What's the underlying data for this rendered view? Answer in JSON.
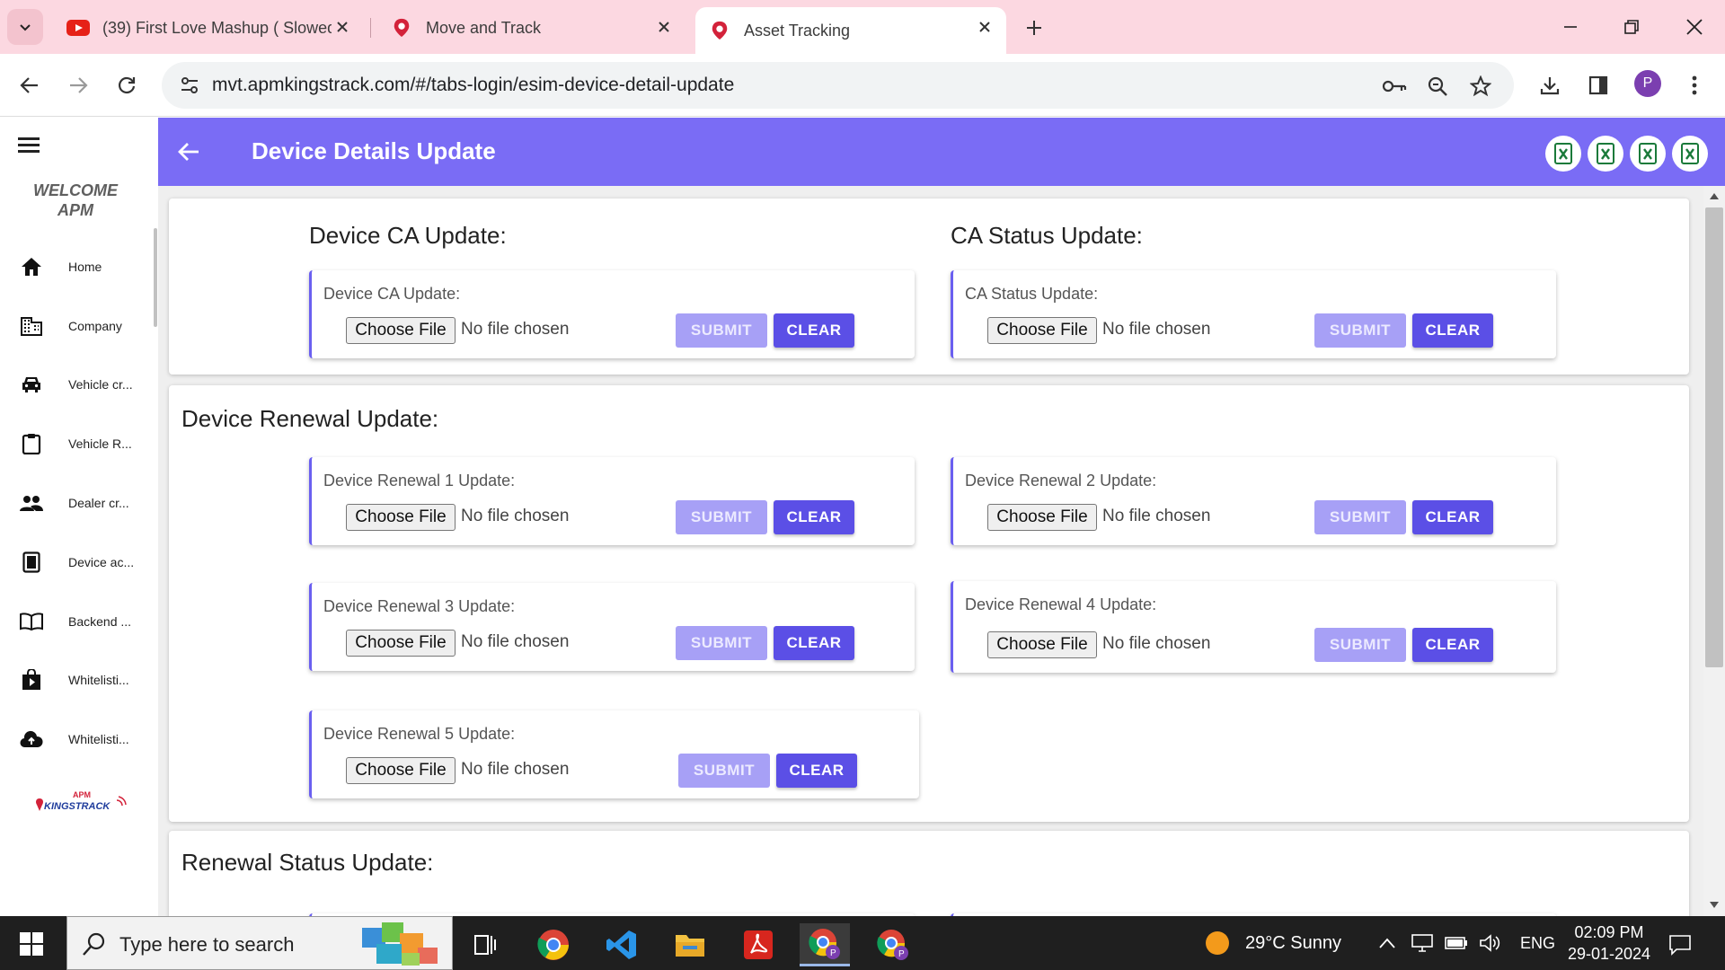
{
  "browser": {
    "tabs": [
      {
        "title": "(39) First Love Mashup ( Slowed"
      },
      {
        "title": "Move and Track"
      },
      {
        "title": "Asset Tracking"
      }
    ],
    "url": "mvt.apmkingstrack.com/#/tabs-login/esim-device-detail-update",
    "profile_initial": "P"
  },
  "sidebar": {
    "welcome_line1": "WELCOME",
    "welcome_line2": "APM",
    "items": [
      {
        "label": "Home",
        "icon": "home-icon"
      },
      {
        "label": "Company",
        "icon": "building-icon"
      },
      {
        "label": "Vehicle cr...",
        "icon": "car-icon"
      },
      {
        "label": "Vehicle R...",
        "icon": "clipboard-icon"
      },
      {
        "label": "Dealer cr...",
        "icon": "people-icon"
      },
      {
        "label": "Device ac...",
        "icon": "calculator-icon"
      },
      {
        "label": "Backend ...",
        "icon": "book-icon"
      },
      {
        "label": "Whitelisti...",
        "icon": "play-bag-icon"
      },
      {
        "label": "Whitelisti...",
        "icon": "cloud-upload-icon"
      }
    ],
    "logo_top": "APM",
    "logo_bottom": "KINGSTRACK"
  },
  "header": {
    "title": "Device Details Update",
    "export_icons": [
      "excel-icon",
      "excel-icon",
      "excel-icon",
      "excel-icon"
    ]
  },
  "sections": {
    "ca_title": "Device CA Update:",
    "ca_status_title": "CA Status Update:",
    "renewal_title": "Device Renewal Update:",
    "renewal_status_title": "Renewal Status Update:"
  },
  "uploads": [
    {
      "label": "Device CA Update:"
    },
    {
      "label": "CA Status Update:"
    },
    {
      "label": "Device Renewal 1 Update:"
    },
    {
      "label": "Device Renewal 2 Update:"
    },
    {
      "label": "Device Renewal 3 Update:"
    },
    {
      "label": "Device Renewal 4 Update:"
    },
    {
      "label": "Device Renewal 5 Update:"
    }
  ],
  "common": {
    "choose_file": "Choose File",
    "no_file": "No file chosen",
    "submit": "SUBMIT",
    "clear": "CLEAR"
  },
  "taskbar": {
    "search_placeholder": "Type here to search",
    "weather": "29°C  Sunny",
    "language": "ENG",
    "time": "02:09 PM",
    "date": "29-01-2024"
  },
  "colors": {
    "accent": "#7a6cf5",
    "clear_button": "#5b4fe6",
    "submit_disabled": "#a7a0f6",
    "tabstrip": "#fcd8e1"
  }
}
